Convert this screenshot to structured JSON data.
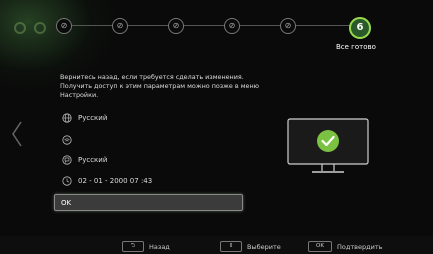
{
  "wizard": {
    "steps": [
      {
        "state": "done"
      },
      {
        "state": "done"
      },
      {
        "state": "done"
      },
      {
        "state": "done"
      },
      {
        "state": "done"
      }
    ],
    "current_step_number": "6",
    "current_step_label": "Все готово"
  },
  "summary": {
    "description": "Вернитесь назад, если требуется сделать изменения. Получить доступ к этим параметрам можно позже в меню Настройки.",
    "items": [
      {
        "icon": "globe-icon",
        "value": "Русский"
      },
      {
        "icon": "network-icon",
        "value": ""
      },
      {
        "icon": "speech-icon",
        "value": "Русский"
      },
      {
        "icon": "clock-icon",
        "value": "02 - 01 - 2000 07 :43"
      }
    ],
    "ok_label": "OK"
  },
  "footer": {
    "back_label": "Назад",
    "select_label": "Выберите",
    "confirm_key": "OK",
    "confirm_label": "Подтвердить"
  },
  "colors": {
    "accent_green": "#7cc242",
    "step_current_ring": "#9adb4e",
    "background": "#0a0a0a"
  }
}
